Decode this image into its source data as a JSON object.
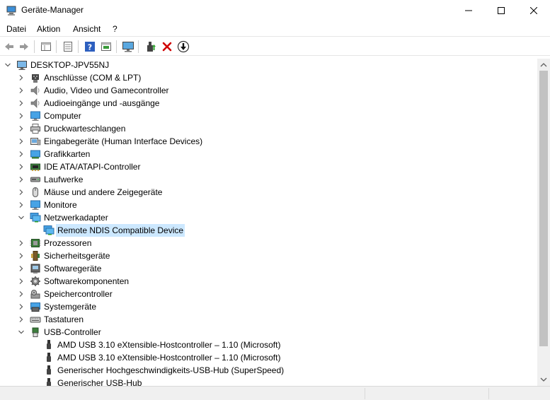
{
  "window": {
    "title": "Geräte-Manager",
    "minimize_glyph": "—",
    "maximize_glyph": "☐",
    "close_glyph": "✕"
  },
  "menu": [
    "Datei",
    "Aktion",
    "Ansicht",
    "?"
  ],
  "toolbar": {
    "icons": [
      "back-arrow-icon",
      "forward-arrow-icon",
      "properties-view-icon",
      "list-view-icon",
      "help-icon",
      "details-icon",
      "monitor-icon",
      "update-driver-icon",
      "uninstall-icon",
      "download-icon"
    ]
  },
  "tree": {
    "root": "DESKTOP-JPV55NJ",
    "categories": [
      {
        "label": "Anschlüsse (COM & LPT)",
        "icon": "port-icon",
        "expanded": false
      },
      {
        "label": "Audio, Video und Gamecontroller",
        "icon": "speaker-icon",
        "expanded": false
      },
      {
        "label": "Audioeingänge und -ausgänge",
        "icon": "speaker-icon",
        "expanded": false
      },
      {
        "label": "Computer",
        "icon": "computer-icon",
        "expanded": false
      },
      {
        "label": "Druckwarteschlangen",
        "icon": "printer-icon",
        "expanded": false
      },
      {
        "label": "Eingabegeräte (Human Interface Devices)",
        "icon": "hid-icon",
        "expanded": false
      },
      {
        "label": "Grafikkarten",
        "icon": "display-adapter-icon",
        "expanded": false
      },
      {
        "label": "IDE ATA/ATAPI-Controller",
        "icon": "ide-controller-icon",
        "expanded": false
      },
      {
        "label": "Laufwerke",
        "icon": "disk-drive-icon",
        "expanded": false
      },
      {
        "label": "Mäuse und andere Zeigegeräte",
        "icon": "mouse-icon",
        "expanded": false
      },
      {
        "label": "Monitore",
        "icon": "monitor-icon",
        "expanded": false
      },
      {
        "label": "Netzwerkadapter",
        "icon": "network-adapter-icon",
        "expanded": true
      },
      {
        "label": "Prozessoren",
        "icon": "processor-icon",
        "expanded": false
      },
      {
        "label": "Sicherheitsgeräte",
        "icon": "security-device-icon",
        "expanded": false
      },
      {
        "label": "Softwaregeräte",
        "icon": "software-device-icon",
        "expanded": false
      },
      {
        "label": "Softwarekomponenten",
        "icon": "software-component-icon",
        "expanded": false
      },
      {
        "label": "Speichercontroller",
        "icon": "storage-controller-icon",
        "expanded": false
      },
      {
        "label": "Systemgeräte",
        "icon": "system-device-icon",
        "expanded": false
      },
      {
        "label": "Tastaturen",
        "icon": "keyboard-icon",
        "expanded": false
      },
      {
        "label": "USB-Controller",
        "icon": "usb-icon",
        "expanded": true
      }
    ],
    "network_children": [
      "Remote NDIS Compatible Device"
    ],
    "usb_children": [
      "AMD USB 3.10 eXtensible-Hostcontroller – 1.10 (Microsoft)",
      "AMD USB 3.10 eXtensible-Hostcontroller – 1.10 (Microsoft)",
      "Generischer Hochgeschwindigkeits-USB-Hub (SuperSpeed)",
      "Generischer USB-Hub"
    ]
  },
  "colors": {
    "selection": "#cce8ff",
    "accent_blue": "#1e88c8",
    "remove_red": "#d00000"
  }
}
